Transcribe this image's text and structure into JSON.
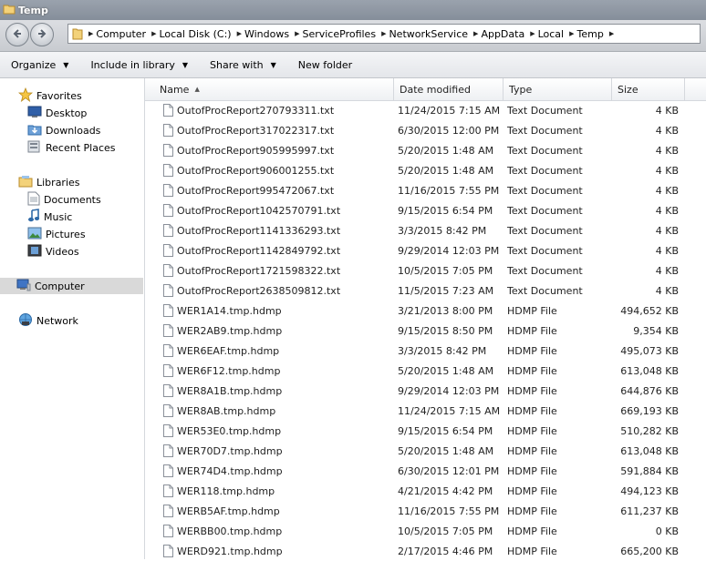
{
  "window": {
    "title": "Temp"
  },
  "breadcrumb": [
    "Computer",
    "Local Disk (C:)",
    "Windows",
    "ServiceProfiles",
    "NetworkService",
    "AppData",
    "Local",
    "Temp"
  ],
  "toolbar": {
    "organize": "Organize",
    "include_in_library": "Include in library",
    "share_with": "Share with",
    "new_folder": "New folder"
  },
  "nav": {
    "favorites": "Favorites",
    "desktop": "Desktop",
    "downloads": "Downloads",
    "recent_places": "Recent Places",
    "libraries": "Libraries",
    "documents": "Documents",
    "music": "Music",
    "pictures": "Pictures",
    "videos": "Videos",
    "computer": "Computer",
    "network": "Network"
  },
  "columns": {
    "name": "Name",
    "date_modified": "Date modified",
    "type": "Type",
    "size": "Size"
  },
  "files": [
    {
      "name": "OutofProcReport270793311.txt",
      "date": "11/24/2015 7:15 AM",
      "type": "Text Document",
      "size": "4 KB"
    },
    {
      "name": "OutofProcReport317022317.txt",
      "date": "6/30/2015 12:00 PM",
      "type": "Text Document",
      "size": "4 KB"
    },
    {
      "name": "OutofProcReport905995997.txt",
      "date": "5/20/2015 1:48 AM",
      "type": "Text Document",
      "size": "4 KB"
    },
    {
      "name": "OutofProcReport906001255.txt",
      "date": "5/20/2015 1:48 AM",
      "type": "Text Document",
      "size": "4 KB"
    },
    {
      "name": "OutofProcReport995472067.txt",
      "date": "11/16/2015 7:55 PM",
      "type": "Text Document",
      "size": "4 KB"
    },
    {
      "name": "OutofProcReport1042570791.txt",
      "date": "9/15/2015 6:54 PM",
      "type": "Text Document",
      "size": "4 KB"
    },
    {
      "name": "OutofProcReport1141336293.txt",
      "date": "3/3/2015 8:42 PM",
      "type": "Text Document",
      "size": "4 KB"
    },
    {
      "name": "OutofProcReport1142849792.txt",
      "date": "9/29/2014 12:03 PM",
      "type": "Text Document",
      "size": "4 KB"
    },
    {
      "name": "OutofProcReport1721598322.txt",
      "date": "10/5/2015 7:05 PM",
      "type": "Text Document",
      "size": "4 KB"
    },
    {
      "name": "OutofProcReport2638509812.txt",
      "date": "11/5/2015 7:23 AM",
      "type": "Text Document",
      "size": "4 KB"
    },
    {
      "name": "WER1A14.tmp.hdmp",
      "date": "3/21/2013 8:00 PM",
      "type": "HDMP File",
      "size": "494,652 KB"
    },
    {
      "name": "WER2AB9.tmp.hdmp",
      "date": "9/15/2015 8:50 PM",
      "type": "HDMP File",
      "size": "9,354 KB"
    },
    {
      "name": "WER6EAF.tmp.hdmp",
      "date": "3/3/2015 8:42 PM",
      "type": "HDMP File",
      "size": "495,073 KB"
    },
    {
      "name": "WER6F12.tmp.hdmp",
      "date": "5/20/2015 1:48 AM",
      "type": "HDMP File",
      "size": "613,048 KB"
    },
    {
      "name": "WER8A1B.tmp.hdmp",
      "date": "9/29/2014 12:03 PM",
      "type": "HDMP File",
      "size": "644,876 KB"
    },
    {
      "name": "WER8AB.tmp.hdmp",
      "date": "11/24/2015 7:15 AM",
      "type": "HDMP File",
      "size": "669,193 KB"
    },
    {
      "name": "WER53E0.tmp.hdmp",
      "date": "9/15/2015 6:54 PM",
      "type": "HDMP File",
      "size": "510,282 KB"
    },
    {
      "name": "WER70D7.tmp.hdmp",
      "date": "5/20/2015 1:48 AM",
      "type": "HDMP File",
      "size": "613,048 KB"
    },
    {
      "name": "WER74D4.tmp.hdmp",
      "date": "6/30/2015 12:01 PM",
      "type": "HDMP File",
      "size": "591,884 KB"
    },
    {
      "name": "WER118.tmp.hdmp",
      "date": "4/21/2015 4:42 PM",
      "type": "HDMP File",
      "size": "494,123 KB"
    },
    {
      "name": "WERB5AF.tmp.hdmp",
      "date": "11/16/2015 7:55 PM",
      "type": "HDMP File",
      "size": "611,237 KB"
    },
    {
      "name": "WERBB00.tmp.hdmp",
      "date": "10/5/2015 7:05 PM",
      "type": "HDMP File",
      "size": "0 KB"
    },
    {
      "name": "WERD921.tmp.hdmp",
      "date": "2/17/2015 4:46 PM",
      "type": "HDMP File",
      "size": "665,200 KB"
    }
  ]
}
